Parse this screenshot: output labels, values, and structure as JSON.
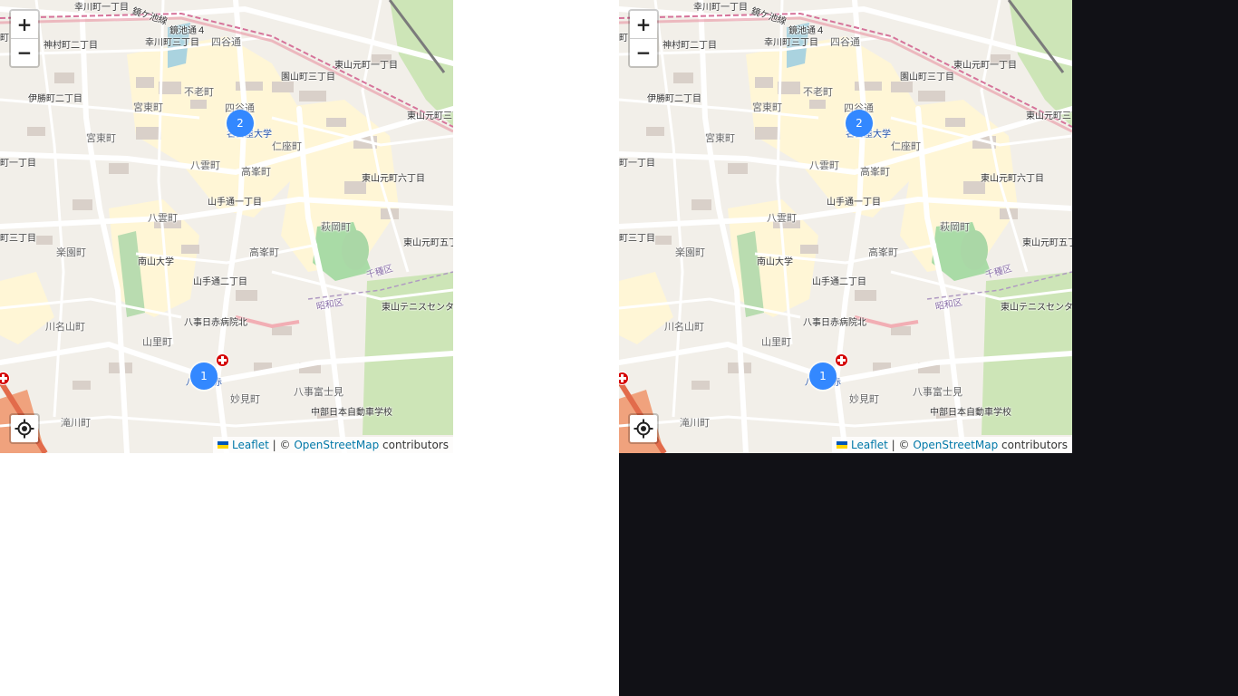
{
  "maps": [
    {
      "zoom_in_label": "+",
      "zoom_out_label": "−",
      "attribution": {
        "leaflet_link": "Leaflet",
        "separator": " | © ",
        "osm_link": "OpenStreetMap",
        "suffix": " contributors"
      },
      "clusters": [
        "2",
        "1"
      ],
      "labels": {
        "sachikawa1": "幸川町一丁目",
        "kagamiike": "鏡ケ池線",
        "kagamiike4": "鏡池通４",
        "sachikawa3": "幸川町三丁目",
        "yotsuya": "四谷通",
        "kamimura2": "神村町二丁目",
        "sonoyama3": "園山町三丁目",
        "higashiyama1": "東山元町一丁目",
        "furo": "不老町",
        "yotsuyadori": "四谷通",
        "ibuka2": "伊勝町二丁目",
        "miyahigashi": "宮東町",
        "miyahigashi2": "宮東町",
        "higashiyama3": "東山元町三丁目",
        "nagoya_univ": "名古屋大学",
        "nizamachi": "仁座町",
        "yakumo": "八雲町",
        "takamine": "高峯町",
        "higashiyama6": "東山元町六丁目",
        "yamate1": "山手通一丁目",
        "yakumo2": "八雲町",
        "hagioka": "萩岡町",
        "yamada3": "町三丁目",
        "rakuen": "楽園町",
        "takamine2": "高峯町",
        "higashiyama5": "東山元町五丁目",
        "nanzan": "南山大学",
        "chikusa": "千種区",
        "yamate2": "山手通二丁目",
        "showa": "昭和区",
        "tennis": "東山テニスセンター",
        "kawanayama": "川名山町",
        "hospital": "八事日赤病院北",
        "yamazato": "山里町",
        "hachiaka": "八事日赤",
        "myoken": "妙見町",
        "yagoto_fuji": "八事富士見",
        "chubu": "中部日本自動車学校",
        "takigawa": "滝川町",
        "yamada1": "町一丁目",
        "bubu": "町"
      }
    },
    {
      "zoom_in_label": "+",
      "zoom_out_label": "−",
      "attribution": {
        "leaflet_link": "Leaflet",
        "separator": " | © ",
        "osm_link": "OpenStreetMap",
        "suffix": " contributors"
      },
      "clusters": [
        "2",
        "1"
      ],
      "labels": {
        "sachikawa1": "幸川町一丁目",
        "kagamiike": "鏡ケ池線",
        "kagamiike4": "鏡池通４",
        "sachikawa3": "幸川町三丁目",
        "yotsuya": "四谷通",
        "kamimura2": "神村町二丁目",
        "sonoyama3": "園山町三丁目",
        "higashiyama1": "東山元町一丁目",
        "furo": "不老町",
        "yotsuyadori": "四谷通",
        "ibuka2": "伊勝町二丁目",
        "miyahigashi": "宮東町",
        "miyahigashi2": "宮東町",
        "higashiyama3": "東山元町三丁目",
        "nagoya_univ": "名古屋大学",
        "nizamachi": "仁座町",
        "yakumo": "八雲町",
        "takamine": "高峯町",
        "higashiyama6": "東山元町六丁目",
        "yamate1": "山手通一丁目",
        "yakumo2": "八雲町",
        "hagioka": "萩岡町",
        "yamada3": "町三丁目",
        "rakuen": "楽園町",
        "takamine2": "高峯町",
        "higashiyama5": "東山元町五丁目",
        "nanzan": "南山大学",
        "chikusa": "千種区",
        "yamate2": "山手通二丁目",
        "showa": "昭和区",
        "tennis": "東山テニスセンター",
        "kawanayama": "川名山町",
        "hospital": "八事日赤病院北",
        "yamazato": "山里町",
        "hachiaka": "八事日赤",
        "myoken": "妙見町",
        "yagoto_fuji": "八事富士見",
        "chubu": "中部日本自動車学校",
        "takigawa": "滝川町",
        "yamada1": "町一丁目",
        "bubu": "町"
      }
    }
  ]
}
